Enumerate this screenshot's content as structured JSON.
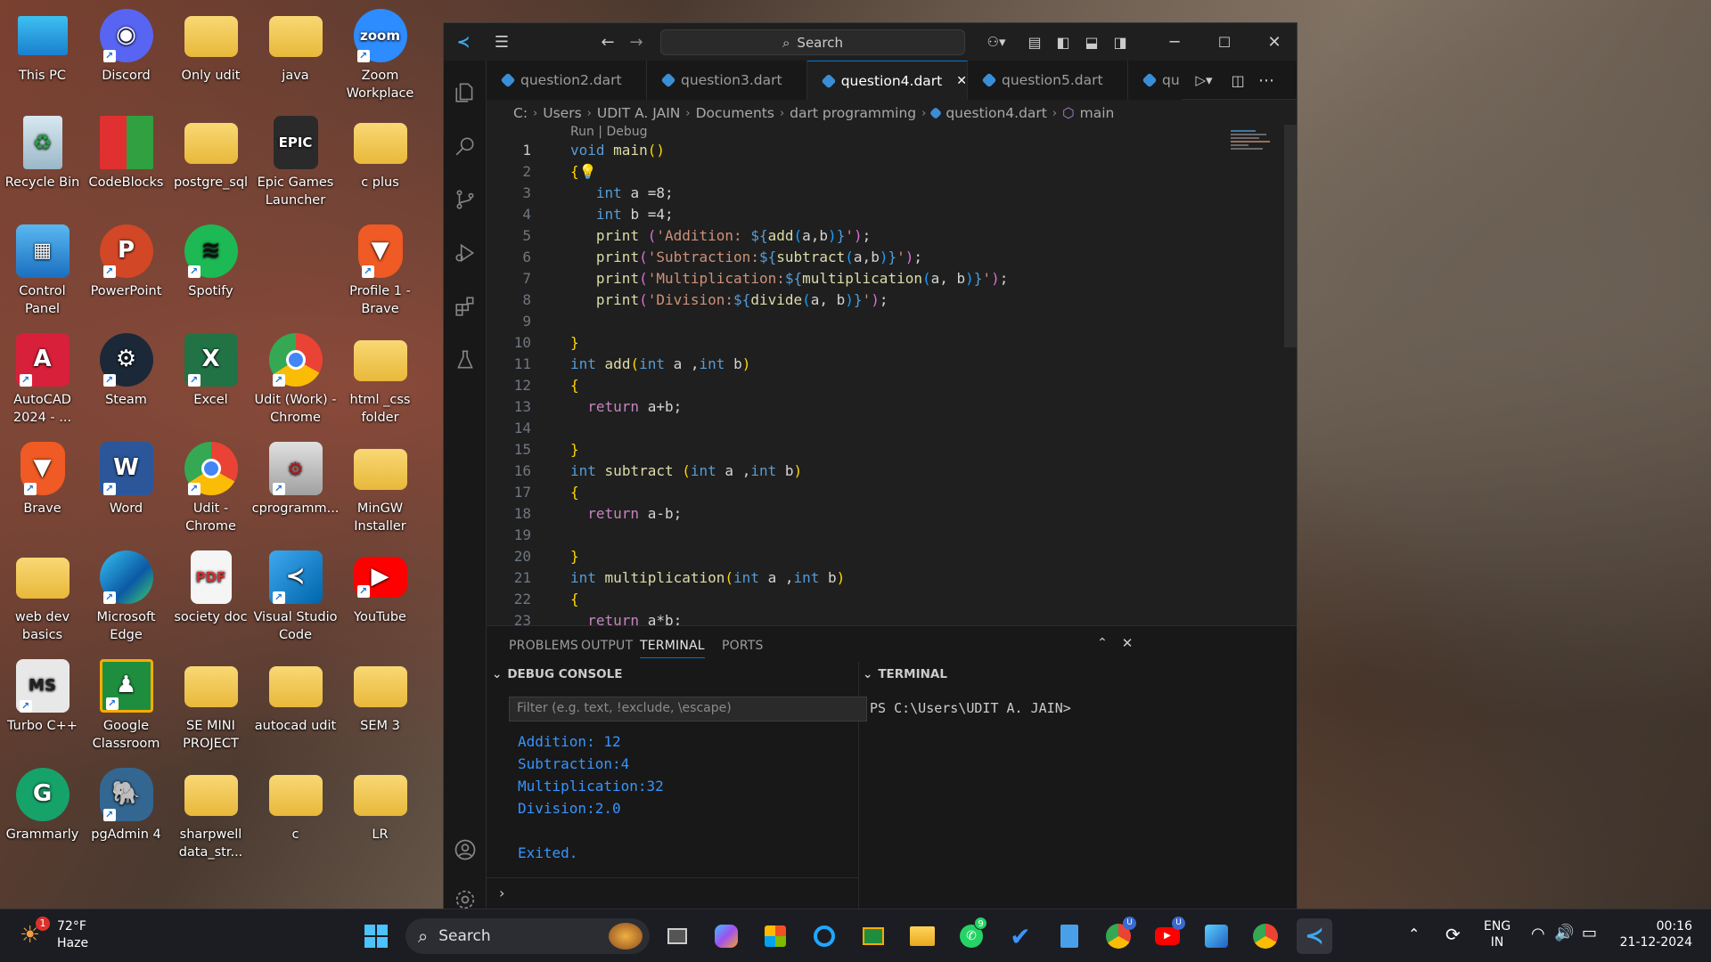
{
  "desktop": {
    "icons": [
      {
        "label": "This PC"
      },
      {
        "label": "Discord"
      },
      {
        "label": "Only udit"
      },
      {
        "label": "java"
      },
      {
        "label": "Zoom Workplace"
      },
      {
        "label": "Recycle Bin"
      },
      {
        "label": "CodeBlocks"
      },
      {
        "label": "postgre_sql"
      },
      {
        "label": "Epic Games Launcher"
      },
      {
        "label": "c plus"
      },
      {
        "label": "Control Panel"
      },
      {
        "label": "PowerPoint"
      },
      {
        "label": "Spotify"
      },
      {
        "label": "Profile 1 - Brave"
      },
      {
        "label": "AutoCAD 2024 - ..."
      },
      {
        "label": "Steam"
      },
      {
        "label": "Excel"
      },
      {
        "label": "Udit (Work) - Chrome"
      },
      {
        "label": "html _css folder"
      },
      {
        "label": "Brave"
      },
      {
        "label": "Word"
      },
      {
        "label": "Udit - Chrome"
      },
      {
        "label": "MinGW Installer"
      },
      {
        "label": "cprogramm..."
      },
      {
        "label": "web dev basics"
      },
      {
        "label": "Microsoft Edge"
      },
      {
        "label": "society doc"
      },
      {
        "label": "Visual Studio Code"
      },
      {
        "label": "YouTube"
      },
      {
        "label": "Turbo C++"
      },
      {
        "label": "Google Classroom"
      },
      {
        "label": "SE MINI PROJECT"
      },
      {
        "label": "autocad udit"
      },
      {
        "label": "SEM 3"
      },
      {
        "label": "Grammarly"
      },
      {
        "label": "pgAdmin 4"
      },
      {
        "label": "sharpwell data_str..."
      },
      {
        "label": "c"
      },
      {
        "label": "LR"
      }
    ],
    "icon_glyphs": {
      "epic": "EPIC",
      "zoom": "zoom",
      "cad": "A",
      "word": "W",
      "excel": "X",
      "ppt": "P",
      "pdf": "PDF",
      "ms": "MS"
    }
  },
  "vscode": {
    "search_placeholder": "Search",
    "tabs": [
      {
        "label": "question2.dart"
      },
      {
        "label": "question3.dart"
      },
      {
        "label": "question4.dart"
      },
      {
        "label": "question5.dart"
      },
      {
        "label": "qu"
      }
    ],
    "breadcrumb": [
      "C:",
      "Users",
      "UDIT A. JAIN",
      "Documents",
      "dart programming",
      "question4.dart",
      "main"
    ],
    "codelens": "Run | Debug",
    "line_numbers": [
      "1",
      "2",
      "3",
      "4",
      "5",
      "6",
      "7",
      "8",
      "9",
      "10",
      "11",
      "12",
      "13",
      "14",
      "15",
      "16",
      "17",
      "18",
      "19",
      "20",
      "21",
      "22",
      "23"
    ],
    "panel": {
      "tabs": [
        "PROBLEMS",
        "OUTPUT",
        "TERMINAL",
        "PORTS"
      ],
      "debug_console_title": "DEBUG CONSOLE",
      "terminal_title": "TERMINAL",
      "filter_placeholder": "Filter (e.g. text, !exclude, \\escape)",
      "console_output": [
        "Addition: 12",
        "Subtraction:4",
        "Multiplication:32",
        "Division:2.0",
        "Exited."
      ],
      "terminal_prompt": "PS C:\\Users\\UDIT A. JAIN>"
    }
  },
  "taskbar": {
    "weather_temp": "72°F",
    "weather_desc": "Haze",
    "weather_badge": "1",
    "search_label": "Search",
    "lang_line1": "ENG",
    "lang_line2": "IN",
    "time": "00:16",
    "date": "21-12-2024",
    "badge_whatsapp": "9",
    "badge_u": "U"
  },
  "colors": {
    "accent": "#0078d4",
    "keyword": "#569cd6",
    "function": "#dcdcaa",
    "string": "#ce9178",
    "console_blue": "#3794ff"
  }
}
